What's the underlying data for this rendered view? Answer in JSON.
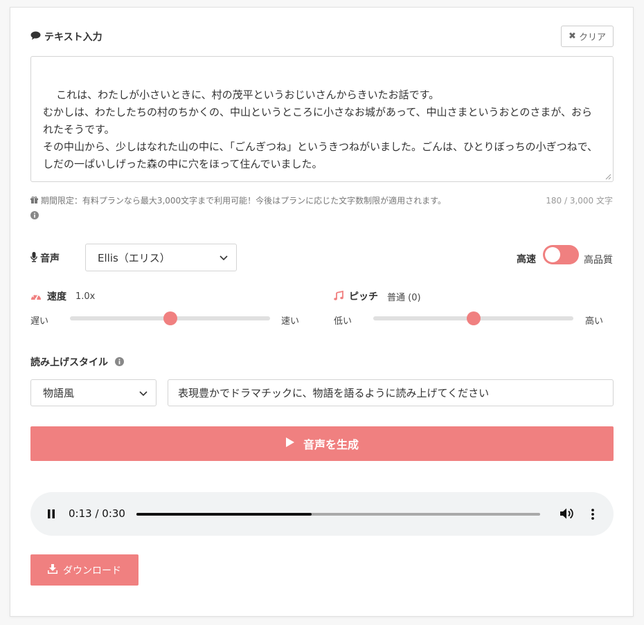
{
  "text_input": {
    "title": "テキスト入力",
    "clear_label": "クリア",
    "value": "これは、わたしが小さいときに、村の茂平というおじいさんからきいたお話です。\nむかしは、わたしたちの村のちかくの、中山というところに小さなお城があって、中山さまというおとのさまが、おられたそうです。\nその中山から、少しはなれた山の中に、「ごんぎつね」というきつねがいました。ごんは、ひとりぼっちの小ぎつねで、しだの一ぱいしげった森の中に穴をほって住んでいました。",
    "notice": "期間限定：有料プランなら最大3,000文字まで利用可能！今後はプランに応じた文字数制限が適用されます。",
    "counter": "180 / 3,000 文字"
  },
  "voice": {
    "label": "音声",
    "selected": "Ellis（エリス）",
    "toggle_left": "高速",
    "toggle_right": "高品質",
    "toggle_on": false
  },
  "speed": {
    "label": "速度",
    "value": "1.0x",
    "min_label": "遅い",
    "max_label": "速い",
    "position": 0.5
  },
  "pitch": {
    "label": "ピッチ",
    "value": "普通 (0)",
    "min_label": "低い",
    "max_label": "高い",
    "position": 0.5
  },
  "style": {
    "label": "読み上げスタイル",
    "selected": "物語風",
    "prompt": "表現豊かでドラマチックに、物語を語るように読み上げてください"
  },
  "generate": {
    "label": "音声を生成"
  },
  "player": {
    "time": "0:13 / 0:30",
    "progress": 0.4333
  },
  "download": {
    "label": "ダウンロード"
  },
  "colors": {
    "accent": "#f08080",
    "border": "#d4d4d4"
  },
  "icons": {
    "title": "comment-icon",
    "clear": "close-icon",
    "notice": "gift-icon",
    "info": "info-icon",
    "voice": "microphone-icon",
    "speed": "dashboard-icon",
    "pitch": "music-note-icon",
    "play": "play-icon",
    "pause": "pause-icon",
    "volume": "volume-icon",
    "menu": "more-vertical-icon",
    "download": "download-icon"
  }
}
